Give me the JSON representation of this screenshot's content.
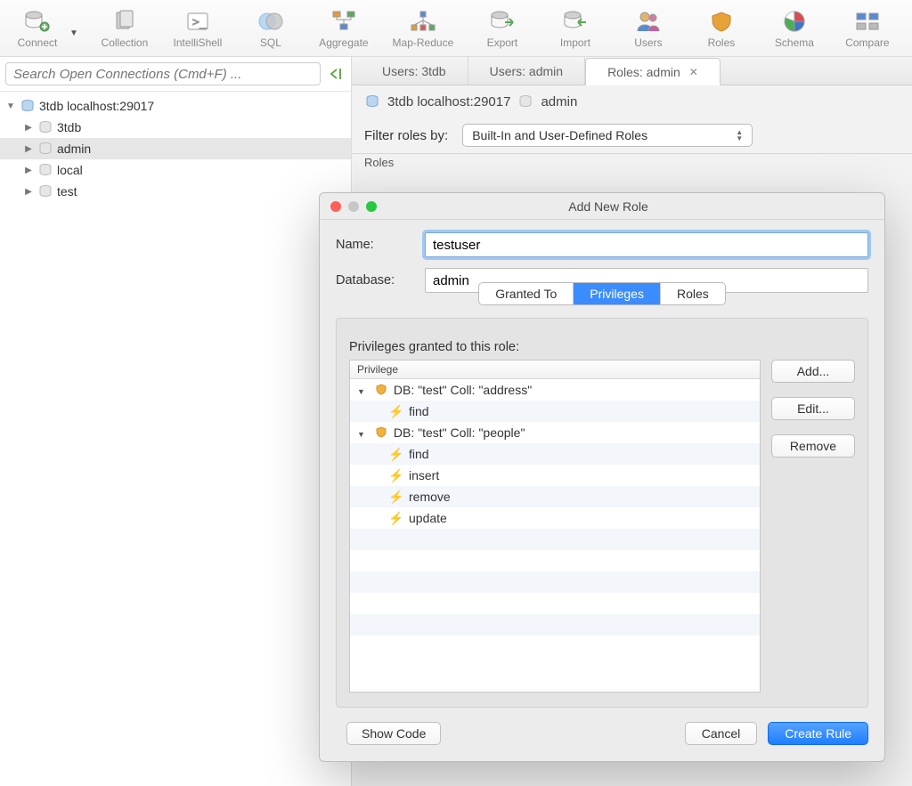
{
  "toolbar": [
    {
      "label": "Connect"
    },
    {
      "label": "Collection"
    },
    {
      "label": "IntelliShell"
    },
    {
      "label": "SQL"
    },
    {
      "label": "Aggregate"
    },
    {
      "label": "Map-Reduce"
    },
    {
      "label": "Export"
    },
    {
      "label": "Import"
    },
    {
      "label": "Users"
    },
    {
      "label": "Roles"
    },
    {
      "label": "Schema"
    },
    {
      "label": "Compare"
    }
  ],
  "search": {
    "placeholder": "Search Open Connections (Cmd+F) ..."
  },
  "tree": {
    "root": "3tdb localhost:29017",
    "children": [
      "3tdb",
      "admin",
      "local",
      "test"
    ],
    "selected": "admin"
  },
  "tabs": [
    {
      "label": "Users: 3tdb",
      "active": false
    },
    {
      "label": "Users: admin",
      "active": false
    },
    {
      "label": "Roles: admin",
      "active": true
    }
  ],
  "breadcrumb": {
    "server": "3tdb localhost:29017",
    "db": "admin"
  },
  "filter": {
    "label": "Filter roles by:",
    "value": "Built-In and User-Defined Roles"
  },
  "roles_heading": "Roles",
  "dialog": {
    "title": "Add New Role",
    "name_label": "Name:",
    "name_value": "testuser",
    "db_label": "Database:",
    "db_value": "admin",
    "segments": [
      "Granted To",
      "Privileges",
      "Roles"
    ],
    "active_segment": "Privileges",
    "priv_caption": "Privileges granted to this role:",
    "priv_header": "Privilege",
    "privileges": [
      {
        "type": "group",
        "label": "DB: \"test\" Coll: \"address\""
      },
      {
        "type": "action",
        "label": "find"
      },
      {
        "type": "group",
        "label": "DB: \"test\" Coll: \"people\""
      },
      {
        "type": "action",
        "label": "find"
      },
      {
        "type": "action",
        "label": "insert"
      },
      {
        "type": "action",
        "label": "remove"
      },
      {
        "type": "action",
        "label": "update"
      }
    ],
    "side_buttons": [
      "Add...",
      "Edit...",
      "Remove"
    ],
    "footer": {
      "show_code": "Show Code",
      "cancel": "Cancel",
      "create": "Create Rule"
    }
  }
}
